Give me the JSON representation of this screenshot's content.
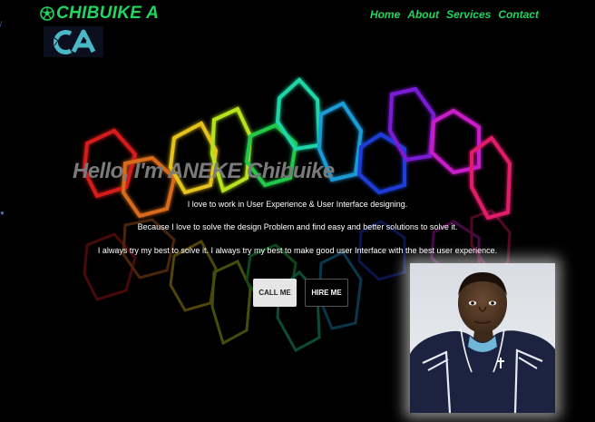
{
  "brand": {
    "name": "CHIBUIKE A",
    "logo_text": "CA",
    "emblem_icon": "soccer-ball-icon"
  },
  "nav": {
    "items": [
      "Home",
      "About",
      "Services",
      "Contact"
    ]
  },
  "hero": {
    "title": "Hello, I'm ANEKE Chibuike",
    "lines": [
      "I love to work in User Experience & User Interface designing.",
      "Because I love to solve the design Problem and find easy and better solutions to solve it.",
      "I always try my best to solve it. I always try my best to make good user Interface with the best user experience."
    ]
  },
  "buttons": {
    "call": "CALL ME",
    "hire": "HIRE ME"
  },
  "colors": {
    "accent": "#1fd65f",
    "background": "#000000"
  }
}
